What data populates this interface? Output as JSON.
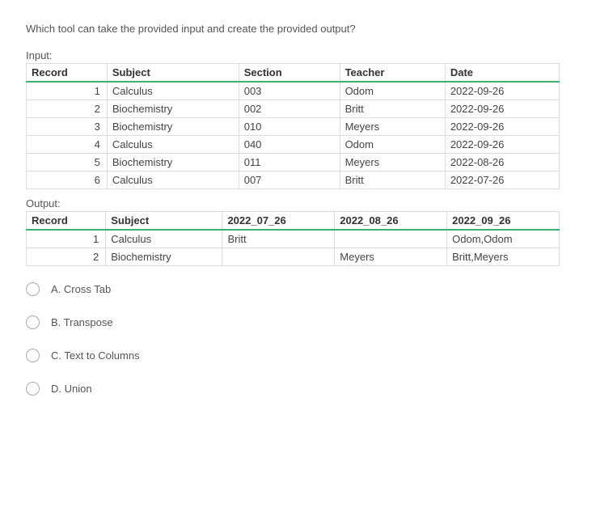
{
  "question": "Which tool can take the provided input and create the provided output?",
  "inputLabel": "Input:",
  "outputLabel": "Output:",
  "inputHeaders": {
    "c1": "Record",
    "c2": "Subject",
    "c3": "Section",
    "c4": "Teacher",
    "c5": "Date"
  },
  "inputRows": [
    {
      "c1": "1",
      "c2": "Calculus",
      "c3": "003",
      "c4": "Odom",
      "c5": "2022-09-26"
    },
    {
      "c1": "2",
      "c2": "Biochemistry",
      "c3": "002",
      "c4": "Britt",
      "c5": "2022-09-26"
    },
    {
      "c1": "3",
      "c2": "Biochemistry",
      "c3": "010",
      "c4": "Meyers",
      "c5": "2022-09-26"
    },
    {
      "c1": "4",
      "c2": "Calculus",
      "c3": "040",
      "c4": "Odom",
      "c5": "2022-09-26"
    },
    {
      "c1": "5",
      "c2": "Biochemistry",
      "c3": "011",
      "c4": "Meyers",
      "c5": "2022-08-26"
    },
    {
      "c1": "6",
      "c2": "Calculus",
      "c3": "007",
      "c4": "Britt",
      "c5": "2022-07-26"
    }
  ],
  "outputHeaders": {
    "c1": "Record",
    "c2": "Subject",
    "c3": "2022_07_26",
    "c4": "2022_08_26",
    "c5": "2022_09_26"
  },
  "outputRows": [
    {
      "c1": "1",
      "c2": "Calculus",
      "c3": "Britt",
      "c4": "",
      "c5": "Odom,Odom"
    },
    {
      "c1": "2",
      "c2": "Biochemistry",
      "c3": "",
      "c4": "Meyers",
      "c5": "Britt,Meyers"
    }
  ],
  "options": {
    "a": "A. Cross Tab",
    "b": "B. Transpose",
    "c": "C. Text to Columns",
    "d": "D. Union"
  }
}
